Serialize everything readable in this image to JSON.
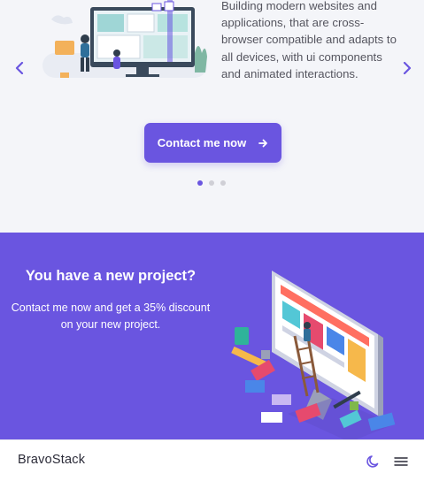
{
  "hero": {
    "description": "Building modern websites and applications, that are cross-browser compatible and adapts to all devices, with ui components and animated interactions.",
    "cta_label": "Contact me now",
    "prev_icon": "chevron-left-icon",
    "next_icon": "chevron-right-icon",
    "cta_icon": "arrow-right-icon",
    "slide_count": 3,
    "active_slide": 1
  },
  "promo": {
    "title": "You have a new project?",
    "subtitle": "Contact me now and get a 35% discount on your new project."
  },
  "navbar": {
    "brand": "BravoStack",
    "theme_icon": "moon-icon",
    "menu_icon": "hamburger-menu-icon"
  },
  "colors": {
    "accent": "#6a55e0",
    "background": "#f4f5f9",
    "navbar_bg": "#ffffff"
  }
}
